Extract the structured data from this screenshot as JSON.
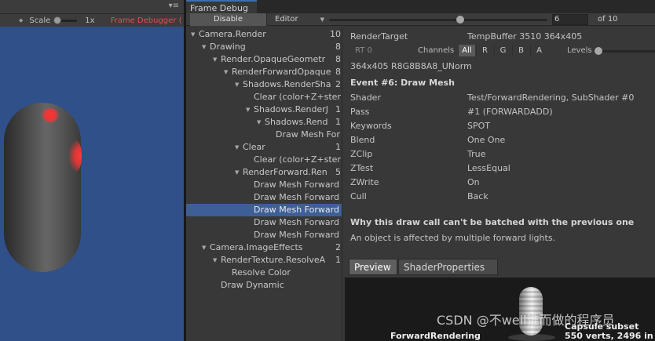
{
  "game_view": {
    "scale_label": "Scale",
    "scale_value": "1x",
    "frame_debugger_label": "Frame Debugger (",
    "menu_dots": "▾≡"
  },
  "frame_debug": {
    "tab_title": "Frame Debug",
    "disable_label": "Disable",
    "editor_label": "Editor",
    "event_index": "6",
    "event_total": "of 10",
    "event_slider_fraction": 0.6
  },
  "tree": [
    {
      "name": "Camera.Render",
      "count": "10",
      "depth": 0,
      "expanded": true,
      "selected": false
    },
    {
      "name": "Drawing",
      "count": "8",
      "depth": 1,
      "expanded": true,
      "selected": false
    },
    {
      "name": "Render.OpaqueGeometr",
      "count": "8",
      "depth": 2,
      "expanded": true,
      "selected": false
    },
    {
      "name": "RenderForwardOpaque",
      "count": "8",
      "depth": 3,
      "expanded": true,
      "selected": false
    },
    {
      "name": "Shadows.RenderSha",
      "count": "2",
      "depth": 4,
      "expanded": true,
      "selected": false
    },
    {
      "name": "Clear (color+Z+ster",
      "count": "",
      "depth": 5,
      "expanded": null,
      "selected": false
    },
    {
      "name": "Shadows.RenderJ",
      "count": "1",
      "depth": 5,
      "expanded": true,
      "selected": false
    },
    {
      "name": "Shadows.Rend",
      "count": "1",
      "depth": 6,
      "expanded": true,
      "selected": false
    },
    {
      "name": "Draw Mesh For",
      "count": "",
      "depth": 7,
      "expanded": null,
      "selected": false
    },
    {
      "name": "Clear",
      "count": "1",
      "depth": 4,
      "expanded": true,
      "selected": false
    },
    {
      "name": "Clear (color+Z+ster",
      "count": "",
      "depth": 5,
      "expanded": null,
      "selected": false
    },
    {
      "name": "RenderForward.Ren",
      "count": "5",
      "depth": 4,
      "expanded": true,
      "selected": false
    },
    {
      "name": "Draw Mesh Forward",
      "count": "",
      "depth": 5,
      "expanded": null,
      "selected": false
    },
    {
      "name": "Draw Mesh Forward",
      "count": "",
      "depth": 5,
      "expanded": null,
      "selected": false
    },
    {
      "name": "Draw Mesh Forward",
      "count": "",
      "depth": 5,
      "expanded": null,
      "selected": true
    },
    {
      "name": "Draw Mesh Forward",
      "count": "",
      "depth": 5,
      "expanded": null,
      "selected": false
    },
    {
      "name": "Draw Mesh Forward",
      "count": "",
      "depth": 5,
      "expanded": null,
      "selected": false
    },
    {
      "name": "Camera.ImageEffects",
      "count": "2",
      "depth": 1,
      "expanded": true,
      "selected": false
    },
    {
      "name": "RenderTexture.ResolveA",
      "count": "1",
      "depth": 2,
      "expanded": true,
      "selected": false
    },
    {
      "name": "Resolve Color",
      "count": "",
      "depth": 3,
      "expanded": null,
      "selected": false
    },
    {
      "name": "Draw Dynamic",
      "count": "",
      "depth": 2,
      "expanded": null,
      "selected": false
    }
  ],
  "detail": {
    "render_target_label": "RenderTarget",
    "render_target_value": "TempBuffer 3510 364x405",
    "rt_dropdown": "RT 0",
    "channels_label": "Channels",
    "channels": [
      "All",
      "R",
      "G",
      "B",
      "A"
    ],
    "active_channel": "All",
    "levels_label": "Levels",
    "format_text": "364x405 R8G8B8A8_UNorm",
    "event_title": "Event #6: Draw Mesh",
    "properties": [
      {
        "key": "Shader",
        "value": "Test/ForwardRendering, SubShader #0"
      },
      {
        "key": "Pass",
        "value": "#1 (FORWARDADD)"
      },
      {
        "key": "Keywords",
        "value": "SPOT"
      },
      {
        "key": "Blend",
        "value": "One One"
      },
      {
        "key": "ZClip",
        "value": "True"
      },
      {
        "key": "ZTest",
        "value": "LessEqual"
      },
      {
        "key": "ZWrite",
        "value": "On"
      },
      {
        "key": "Cull",
        "value": "Back"
      }
    ],
    "batch_title": "Why this draw call can't be batched with the previous one",
    "batch_reason": "An object is affected by multiple forward lights.",
    "preview_tabs": [
      "Preview",
      "ShaderProperties"
    ],
    "active_preview_tab": "Preview",
    "preview_caption": "ForwardRendering",
    "preview_mesh_name": "Capsule subset",
    "preview_stats": "550 verts, 2496 in",
    "watermark": "CSDN @不weil谁而做的程序员"
  }
}
